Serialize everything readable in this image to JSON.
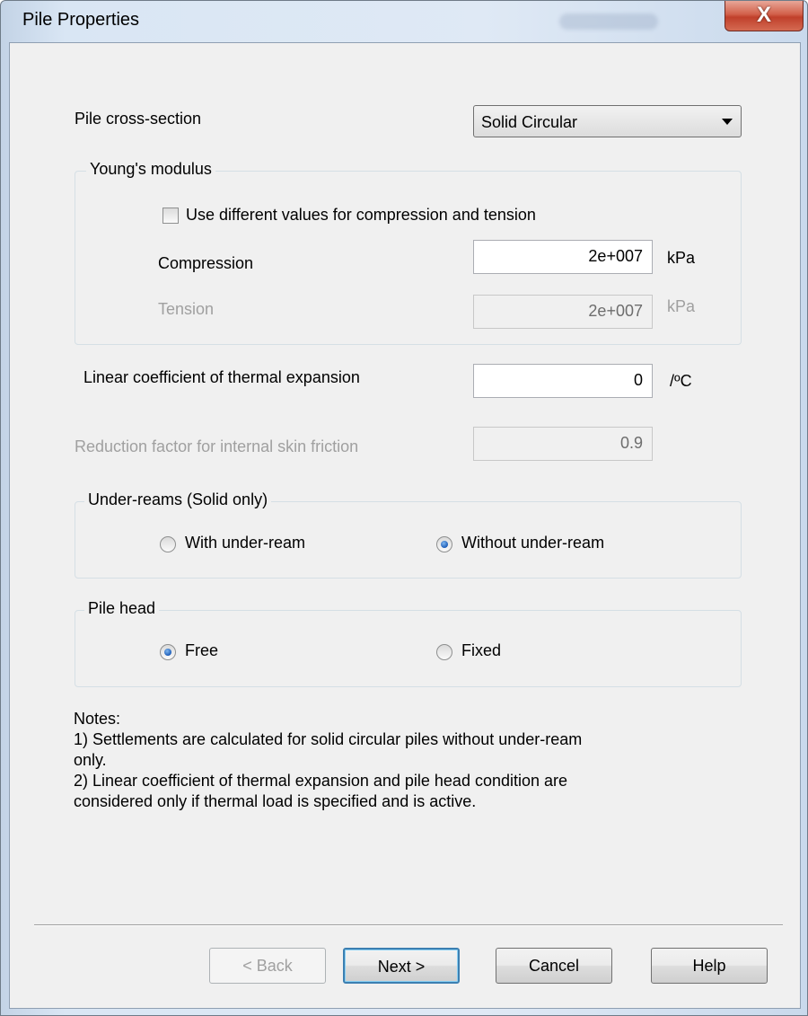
{
  "window": {
    "title": "Pile Properties",
    "close_glyph": "X"
  },
  "cross_section": {
    "label": "Pile cross-section",
    "selected": "Solid Circular"
  },
  "youngs_modulus": {
    "legend": "Young's modulus",
    "use_different_label": "Use different values for compression and tension",
    "use_different_checked": false,
    "compression_label": "Compression",
    "compression_value": "2e+007",
    "compression_unit": "kPa",
    "tension_label": "Tension",
    "tension_value": "2e+007",
    "tension_unit": "kPa"
  },
  "thermal": {
    "label": "Linear coefficient of thermal expansion",
    "value": "0",
    "unit": "/ºC"
  },
  "reduction": {
    "label": "Reduction factor for internal skin friction",
    "value": "0.9"
  },
  "under_reams": {
    "legend": "Under-reams (Solid only)",
    "option_with": "With under-ream",
    "option_without": "Without under-ream",
    "selected": "Without under-ream"
  },
  "pile_head": {
    "legend": "Pile head",
    "option_free": "Free",
    "option_fixed": "Fixed",
    "selected": "Free"
  },
  "notes": {
    "heading": "Notes:",
    "line1": "1)  Settlements are calculated for solid circular piles without under-ream",
    "line2": "only.",
    "line3": "2)  Linear coefficient of thermal expansion and pile head condition are",
    "line4": "considered only if thermal load is specified and is active."
  },
  "buttons": {
    "back": "< Back",
    "next": "Next >",
    "cancel": "Cancel",
    "help": "Help"
  }
}
